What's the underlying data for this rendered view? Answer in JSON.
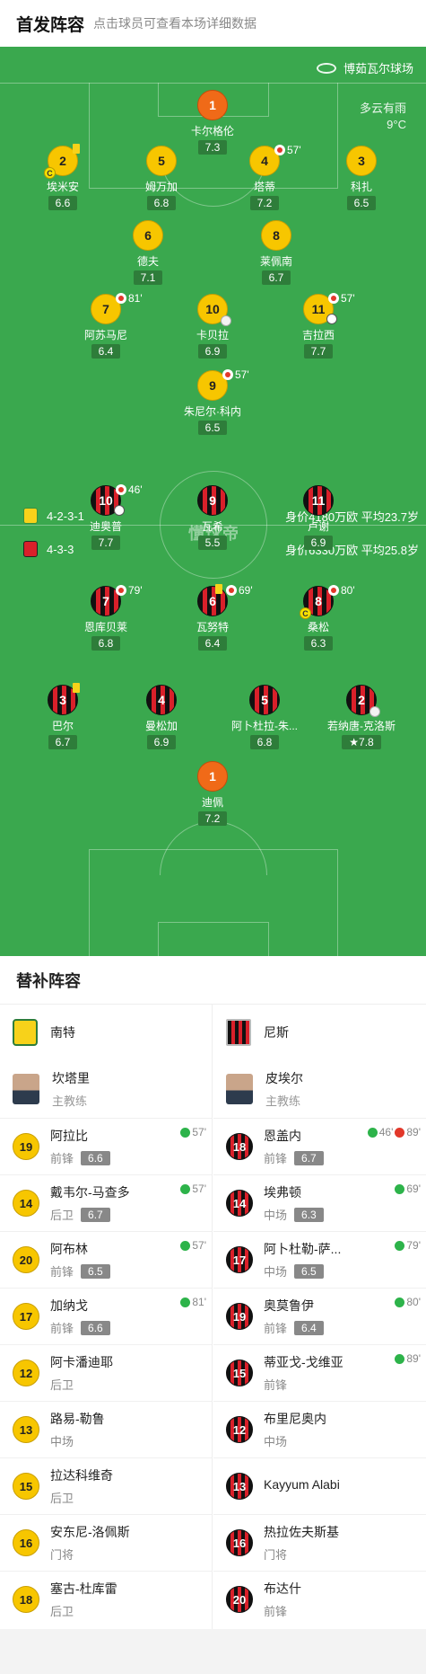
{
  "header": {
    "title": "首发阵容",
    "subtitle": "点击球员可查看本场详细数据"
  },
  "pitch": {
    "stadium": "博茹瓦尔球场",
    "weather": "多云有雨",
    "temperature": "9°C",
    "watermark": "懂球帝",
    "home_formation": "4-2-3-1",
    "home_value": "身价4180万欧 平均23.7岁",
    "away_formation": "4-3-3",
    "away_value": "身价6330万欧 平均25.8岁"
  },
  "home_players": [
    {
      "num": "1",
      "name": "卡尔格伦",
      "rating": "7.3",
      "gk": true
    },
    {
      "num": "2",
      "name": "埃米安",
      "rating": "6.6",
      "card": "yellow",
      "captain": true
    },
    {
      "num": "5",
      "name": "姆万加",
      "rating": "6.8"
    },
    {
      "num": "4",
      "name": "塔蒂",
      "rating": "7.2",
      "sub_off": "57'"
    },
    {
      "num": "3",
      "name": "科扎",
      "rating": "6.5"
    },
    {
      "num": "6",
      "name": "德夫",
      "rating": "7.1"
    },
    {
      "num": "8",
      "name": "莱佩南",
      "rating": "6.7"
    },
    {
      "num": "7",
      "name": "阿苏马尼",
      "rating": "6.4",
      "sub_off": "81'"
    },
    {
      "num": "10",
      "name": "卡贝拉",
      "rating": "6.9",
      "ball": true
    },
    {
      "num": "11",
      "name": "吉拉西",
      "rating": "7.7",
      "sub_off": "57'",
      "ball": true
    },
    {
      "num": "9",
      "name": "朱尼尔·科内",
      "rating": "6.5",
      "sub_off": "57'"
    }
  ],
  "away_players": [
    {
      "num": "10",
      "name": "迪奥普",
      "rating": "7.7",
      "sub_off": "46'",
      "ball": true
    },
    {
      "num": "9",
      "name": "瓦希",
      "rating": "5.5"
    },
    {
      "num": "11",
      "name": "卢谢",
      "rating": "6.9"
    },
    {
      "num": "7",
      "name": "恩库贝莱",
      "rating": "6.8",
      "sub_off": "79'"
    },
    {
      "num": "6",
      "name": "瓦努特",
      "rating": "6.4",
      "card": "yellow",
      "sub_off": "69'"
    },
    {
      "num": "8",
      "name": "桑松",
      "rating": "6.3",
      "sub_off": "80'",
      "captain": true
    },
    {
      "num": "3",
      "name": "巴尔",
      "rating": "6.7",
      "card": "yellow"
    },
    {
      "num": "4",
      "name": "曼松加",
      "rating": "6.9"
    },
    {
      "num": "5",
      "name": "阿卜杜拉-朱...",
      "rating": "6.8"
    },
    {
      "num": "2",
      "name": "若纳唐-克洛斯",
      "rating": "7.8",
      "best": true,
      "ball": true
    },
    {
      "num": "1",
      "name": "迪佩",
      "rating": "7.2",
      "gk": true
    }
  ],
  "subs": {
    "title": "替补阵容",
    "home": {
      "team": "南特",
      "coach": {
        "name": "坎塔里",
        "role": "主教练"
      },
      "players": [
        {
          "num": "19",
          "name": "阿拉比",
          "pos": "前锋",
          "rating": "6.6",
          "in": "57'"
        },
        {
          "num": "14",
          "name": "戴韦尔-马查多",
          "pos": "后卫",
          "rating": "6.7",
          "in": "57'"
        },
        {
          "num": "20",
          "name": "阿布林",
          "pos": "前锋",
          "rating": "6.5",
          "in": "57'"
        },
        {
          "num": "17",
          "name": "加纳戈",
          "pos": "前锋",
          "rating": "6.6",
          "in": "81'"
        },
        {
          "num": "12",
          "name": "阿卡潘迪耶",
          "pos": "后卫"
        },
        {
          "num": "13",
          "name": "路易-勒鲁",
          "pos": "中场"
        },
        {
          "num": "15",
          "name": "拉达科维奇",
          "pos": "后卫"
        },
        {
          "num": "16",
          "name": "安东尼-洛佩斯",
          "pos": "门将"
        },
        {
          "num": "18",
          "name": "塞古-杜库雷",
          "pos": "后卫"
        }
      ]
    },
    "away": {
      "team": "尼斯",
      "coach": {
        "name": "皮埃尔",
        "role": "主教练"
      },
      "players": [
        {
          "num": "18",
          "name": "恩盖内",
          "pos": "前锋",
          "rating": "6.7",
          "in": "46'",
          "out": "89'"
        },
        {
          "num": "14",
          "name": "埃弗顿",
          "pos": "中场",
          "rating": "6.3",
          "in": "69'"
        },
        {
          "num": "17",
          "name": "阿卜杜勒-萨...",
          "pos": "中场",
          "rating": "6.5",
          "in": "79'"
        },
        {
          "num": "19",
          "name": "奥莫鲁伊",
          "pos": "前锋",
          "rating": "6.4",
          "in": "80'"
        },
        {
          "num": "15",
          "name": "蒂亚戈-戈维亚",
          "pos": "前锋",
          "in": "89'"
        },
        {
          "num": "12",
          "name": "布里尼奥内",
          "pos": "中场"
        },
        {
          "num": "13",
          "name": "Kayyum Alabi",
          "pos": ""
        },
        {
          "num": "16",
          "name": "热拉佐夫斯基",
          "pos": "门将"
        },
        {
          "num": "20",
          "name": "布达什",
          "pos": "前锋"
        }
      ]
    }
  }
}
